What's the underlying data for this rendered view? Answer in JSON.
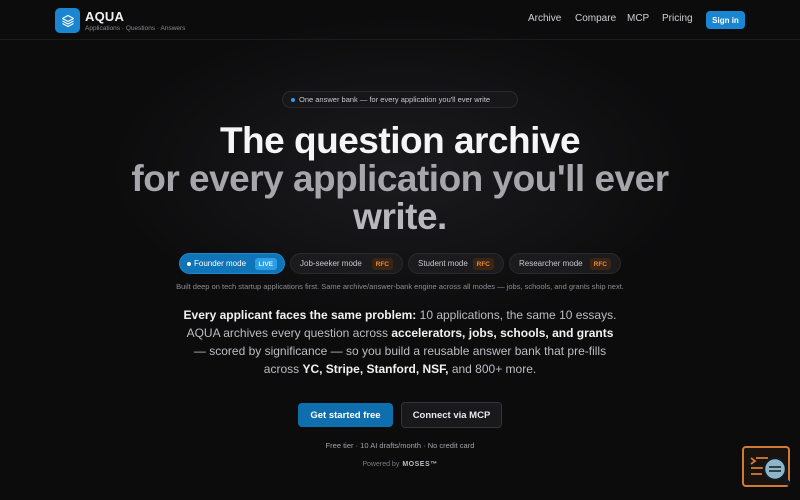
{
  "header": {
    "brand_name": "AQUA",
    "brand_tagline": "Applications · Questions · Answers",
    "nav": [
      "Archive",
      "Compare",
      "MCP",
      "Pricing"
    ],
    "signin_label": "Sign in"
  },
  "hero": {
    "pill_text": "One answer bank — for every application you'll ever write",
    "headline_line1": "The question archive",
    "headline_line2": "for every application you'll ever",
    "headline_line3": "write.",
    "modes": [
      {
        "label": "Founder mode",
        "badge": "LIVE"
      },
      {
        "label": "Job-seeker mode",
        "badge": "RFC"
      },
      {
        "label": "Student mode",
        "badge": "RFC"
      },
      {
        "label": "Researcher mode",
        "badge": "RFC"
      }
    ],
    "subnote": "Built deep on tech startup applications first. Same archive/answer-bank engine across all modes — jobs, schools, and grants ship next.",
    "para": {
      "p1": "Every applicant faces the same problem:",
      "p2": " 10 applications, the same 10 essays. AQUA archives every question across ",
      "p3": "accelerators, jobs, schools, and grants",
      "p4": " — scored by significance — so you build a reusable answer bank that pre-fills across ",
      "p5": "YC, Stripe, Stanford, NSF,",
      "p6": " and 800+ more."
    },
    "cta_primary": "Get started free",
    "cta_secondary": "Connect via MCP",
    "fine_print": "Free tier · 10 AI drafts/month · No credit card",
    "powered_by": "Powered by",
    "powered_brand": "MOSES™"
  },
  "colors": {
    "accent": "#1a86d1",
    "background": "#0c0c0d",
    "rfc_badge": "#e58c40"
  }
}
